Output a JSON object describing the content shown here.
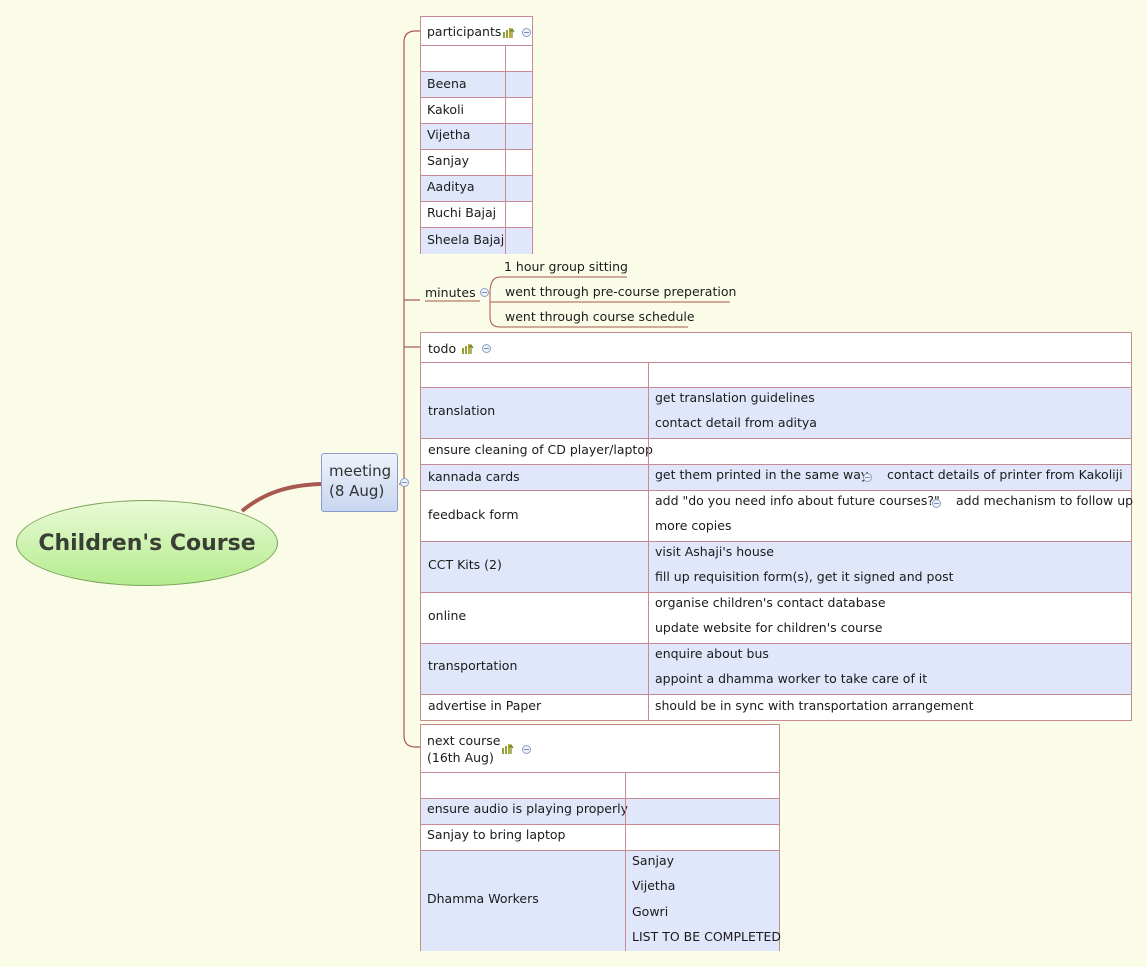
{
  "central": {
    "title": "Children's Course"
  },
  "meeting": {
    "line1": "meeting",
    "line2": "(8 Aug)"
  },
  "participants": {
    "title": "participants",
    "icon": "task-progress-icon",
    "rows": [
      "Beena",
      "Kakoli",
      "Vijetha",
      "Sanjay",
      "Aaditya",
      "Ruchi Bajaj",
      "Sheela Bajaj"
    ]
  },
  "minutes": {
    "title": "minutes",
    "items": [
      "1 hour group sitting",
      "went through pre-course preperation",
      "went through course schedule"
    ]
  },
  "todo": {
    "title": "todo",
    "icon": "task-progress-icon",
    "rows": [
      {
        "task": "translation",
        "details": [
          "get translation guidelines",
          "contact detail from aditya"
        ]
      },
      {
        "task": "ensure cleaning of CD player/laptop",
        "details": []
      },
      {
        "task": "kannada cards",
        "details": [
          "get them printed in the same way"
        ],
        "subtopic": "contact details of printer from Kakoliji"
      },
      {
        "task": "feedback form",
        "details": [
          "add \"do you need info about future courses?\"",
          "more copies"
        ],
        "subtopic": "add mechanism to follow up"
      },
      {
        "task": "CCT Kits (2)",
        "details": [
          "visit Ashaji's house",
          "fill up requisition form(s), get it signed and post"
        ]
      },
      {
        "task": "online",
        "details": [
          "organise children's contact database",
          "update website for children's course"
        ]
      },
      {
        "task": "transportation",
        "details": [
          "enquire about bus",
          "appoint a dhamma worker to take care of it"
        ]
      },
      {
        "task": "advertise in Paper",
        "details": [
          "should be in sync with transportation arrangement"
        ]
      }
    ]
  },
  "next_course": {
    "title_line1": "next course",
    "title_line2": "(16th Aug)",
    "icon": "task-progress-icon",
    "rows": [
      {
        "task": "ensure audio is playing properly",
        "details": []
      },
      {
        "task": "Sanjay to bring laptop",
        "details": []
      },
      {
        "task": "Dhamma Workers",
        "details": [
          "Sanjay",
          "Vijetha",
          "Gowri",
          "LIST TO BE COMPLETED"
        ]
      }
    ]
  },
  "colors": {
    "background": "#fbfce8",
    "row_alt": "#e0e7fa",
    "table_border": "#c58a92",
    "central_fill": "#b4ec8e",
    "branch_line": "#a8584f"
  }
}
